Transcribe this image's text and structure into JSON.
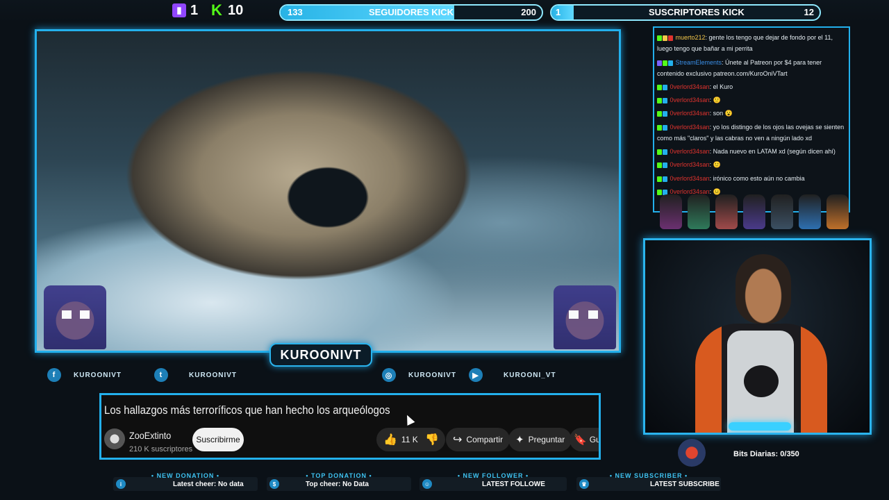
{
  "top": {
    "twitch_count": "1",
    "kick_count": "10",
    "kick_followers": {
      "label": "SEGUIDORES KICK",
      "current": "133",
      "goal": "200",
      "progress": 0.665
    },
    "kick_subs": {
      "label": "SUSCRIPTORES KICK",
      "current": "1",
      "goal": "12",
      "progress": 0.083
    }
  },
  "channel_name": "KUROONIVT",
  "socials": [
    {
      "icon": "facebook-icon",
      "glyph": "f",
      "handle": "KUROONIVT"
    },
    {
      "icon": "twitter-icon",
      "glyph": "t",
      "handle": "KUROONIVT"
    },
    {
      "icon": "instagram-icon",
      "glyph": "◎",
      "handle": "KUROONIVT"
    },
    {
      "icon": "youtube-icon",
      "glyph": "▶",
      "handle": "KUROONI_VT"
    }
  ],
  "youtube": {
    "title": "Los hallazgos más terroríficos que han hecho los arqueólogos",
    "channel": "ZooExtinto",
    "subscribers": "210 K suscriptores",
    "subscribe_label": "Suscribirme",
    "likes": "11 K",
    "share_label": "Compartir",
    "ask_label": "Preguntar",
    "save_label": "Gu"
  },
  "alerts": [
    {
      "head": "• NEW DONATION •",
      "body": "Latest cheer: No data",
      "icon": "info-icon",
      "glyph": "i"
    },
    {
      "head": "• TOP DONATION •",
      "body": "Top cheer: No Data",
      "icon": "bag-icon",
      "glyph": "$"
    },
    {
      "head": "• NEW FOLLOWER •",
      "body": "LATEST FOLLOWE",
      "icon": "user-icon",
      "glyph": "☺"
    },
    {
      "head": "• NEW SUBSCRIBER •",
      "body": "LATEST SUBSCRIBE",
      "icon": "crown-icon",
      "glyph": "♛"
    }
  ],
  "chat": [
    {
      "user": "muerto212",
      "color": "yellow",
      "text": ": gente los tengo que dejar de fondo por el 11, luego tengo que bañar a mi perrita"
    },
    {
      "user": "StreamElements",
      "color": "blue",
      "text": ": Únete al Patreon por $4 para tener contenido exclusivo patreon.com/KuroOniVTart"
    },
    {
      "user": "0verlord34san",
      "color": "red",
      "text": ": el Kuro"
    },
    {
      "user": "0verlord34san",
      "color": "red",
      "text": ": 🙂"
    },
    {
      "user": "0verlord34san",
      "color": "red",
      "text": ": son 😮"
    },
    {
      "user": "0verlord34san",
      "color": "red",
      "text": ": yo los distingo de los ojos las ovejas se sienten como más \"claros\" y las cabras no ven a ningún lado xd"
    },
    {
      "user": "0verlord34san",
      "color": "red",
      "text": ": Nada nuevo en LATAM xd (según dicen ahí)"
    },
    {
      "user": "0verlord34san",
      "color": "red",
      "text": ": 🙂"
    },
    {
      "user": "0verlord34san",
      "color": "red",
      "text": ": irónico como esto aún no cambia"
    },
    {
      "user": "0verlord34san",
      "color": "red",
      "text": ": 😐"
    }
  ],
  "bits": {
    "label": "Bits Diarias:",
    "value": "0/350"
  },
  "colors": {
    "accent": "#23b0ec",
    "kick": "#53fc18",
    "twitch": "#9146ff"
  }
}
